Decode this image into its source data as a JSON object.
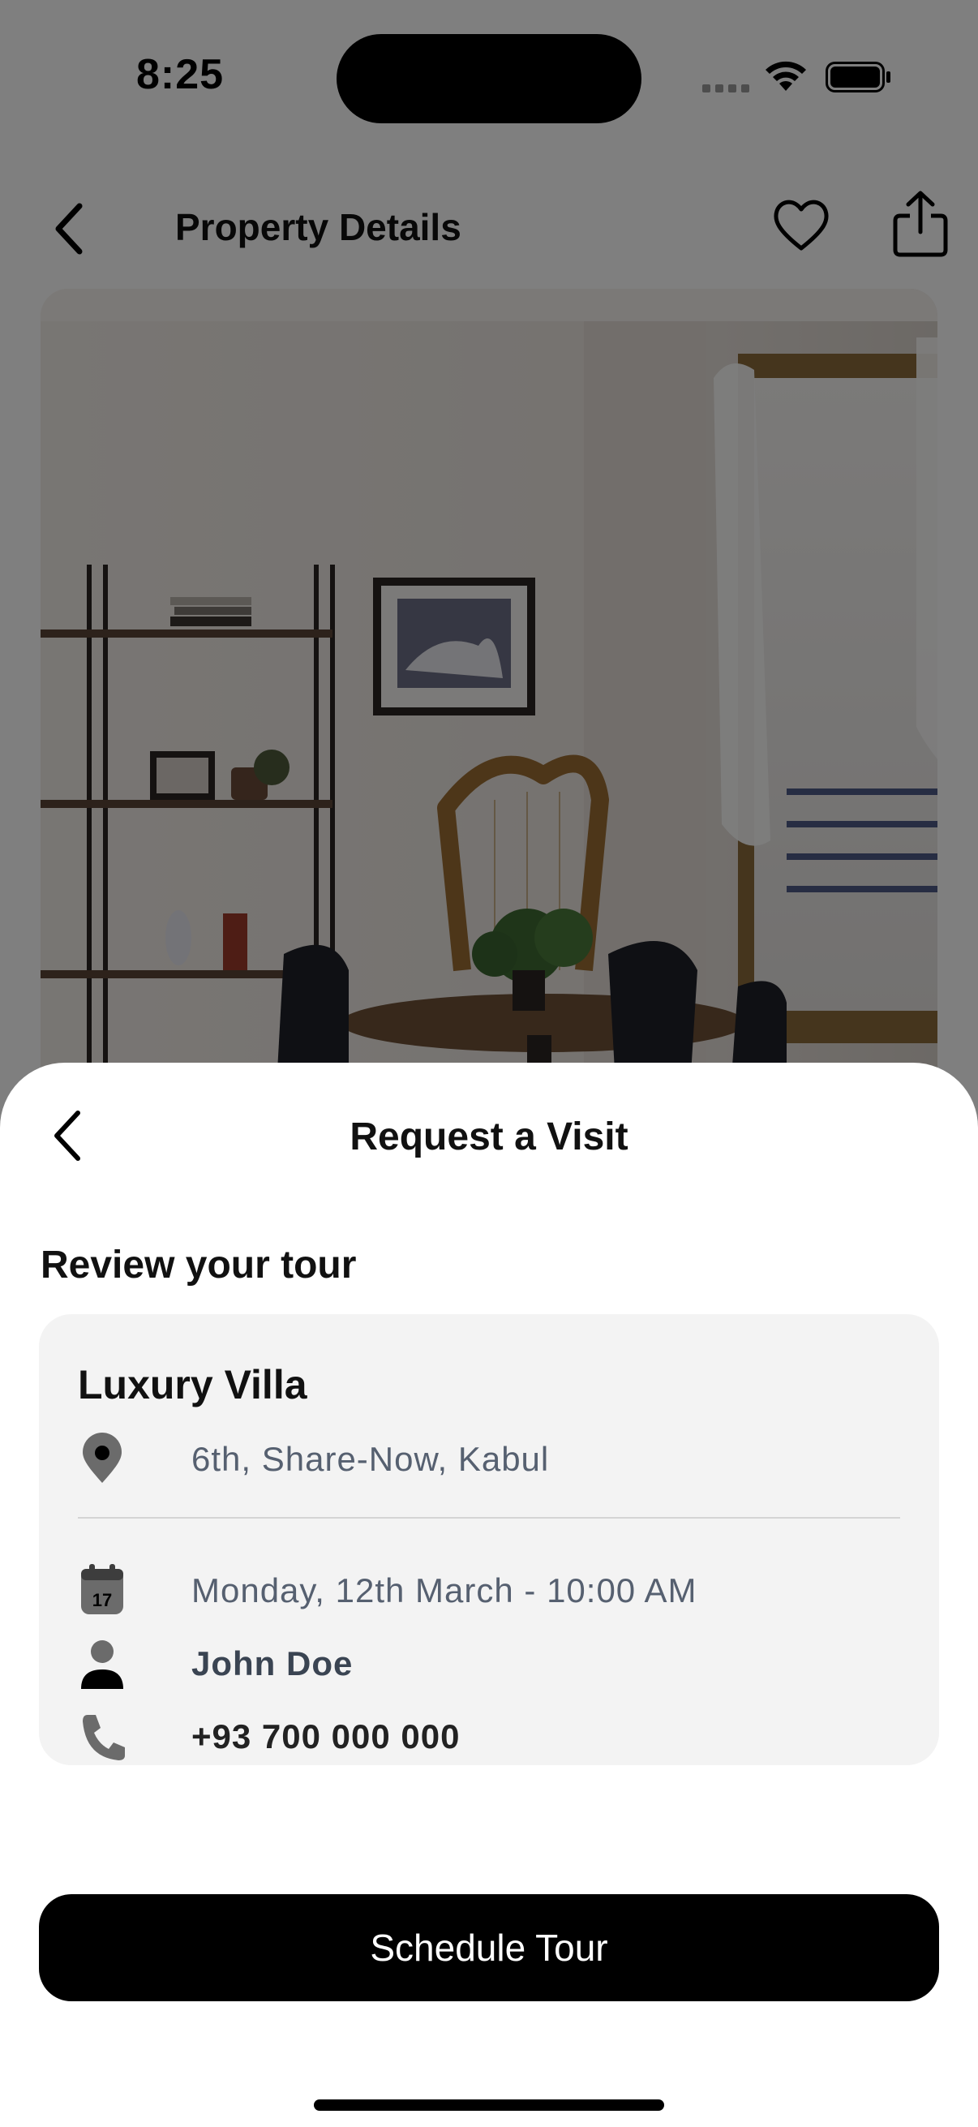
{
  "status_bar": {
    "time": "8:25"
  },
  "header": {
    "title": "Property Details"
  },
  "sheet": {
    "title": "Request a Visit",
    "section_title": "Review your tour",
    "property": {
      "name": "Luxury Villa",
      "address": "6th, Share-Now, Kabul"
    },
    "tour": {
      "datetime": "Monday, 12th March - 10:00 AM",
      "contact_name": "John Doe",
      "phone": "+93 700 000 000"
    },
    "cta_label": "Schedule Tour"
  },
  "icons": {
    "back": "chevron-left-icon",
    "favorite": "heart-icon",
    "share": "share-icon",
    "location": "location-pin-icon",
    "calendar": "calendar-icon",
    "person": "person-icon",
    "phone": "phone-icon"
  },
  "colors": {
    "cta_background": "#000000",
    "card_background": "#f3f3f3",
    "overlay": "rgba(0,0,0,0.5)"
  }
}
